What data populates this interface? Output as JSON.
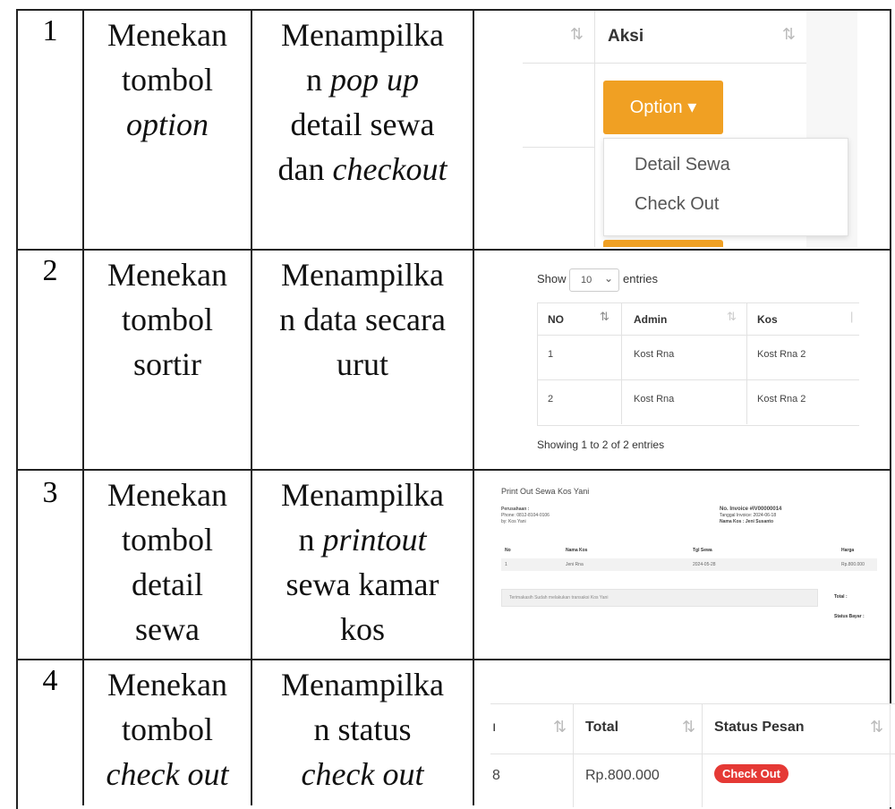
{
  "rows": [
    {
      "no": "1",
      "action_lines": [
        "Menekan",
        "tombol",
        "option"
      ],
      "result_lines": [
        "Menampilka",
        "n pop up",
        "detail sewa",
        "dan checkout"
      ]
    },
    {
      "no": "2",
      "action_lines": [
        "Menekan",
        "tombol",
        "sortir"
      ],
      "result_lines": [
        "Menampilka",
        "n data secara",
        "urut"
      ]
    },
    {
      "no": "3",
      "action_lines": [
        "Menekan",
        "tombol",
        "detail",
        "sewa"
      ],
      "result_lines": [
        "Menampilka",
        "n printout",
        "sewa kamar",
        "kos"
      ]
    },
    {
      "no": "4",
      "action_lines": [
        "Menekan",
        "tombol",
        "check out"
      ],
      "result_lines": [
        "Menampilka",
        "n status",
        "check out"
      ]
    }
  ],
  "shot1": {
    "header_aksi": "Aksi",
    "option_button": "Option ▾",
    "menu_items": [
      "Detail Sewa",
      "Check Out"
    ]
  },
  "shot2": {
    "show_label": "Show",
    "select_value": "10",
    "entries_label": "entries",
    "headers": [
      "NO",
      "Admin",
      "Kos"
    ],
    "rows": [
      [
        "1",
        "Kost Rna",
        "Kost Rna 2"
      ],
      [
        "2",
        "Kost Rna",
        "Kost Rna 2"
      ]
    ],
    "footer": "Showing 1 to 2 of 2 entries"
  },
  "shot3": {
    "title": "Print Out Sewa Kos Yani",
    "left_lines": [
      "Perusahaan :",
      "Phone: 0812-8104-0106",
      "by: Kos Yani"
    ],
    "right_lines": [
      "No. Invoice #IV00000014",
      "Tanggal Invoice: 2024-06-18",
      "Nama Kos : Jeni Susanto"
    ],
    "headers": [
      "No",
      "Nama Kos",
      "Tgl Sewa",
      "Harga"
    ],
    "row": [
      "1",
      "Jeni Rna",
      "2024-05-28",
      "Rp.800.000"
    ],
    "note": "Terimakasih Sudah melakukan transaksi Kos Yani",
    "total_label": "Total :",
    "status_label": "Status Bayar :"
  },
  "shot4": {
    "headers": [
      "Total",
      "Status Pesan"
    ],
    "left_fragment": "8",
    "total_value": "Rp.800.000",
    "badge": "Check Out",
    "badge_color": "#e53935"
  }
}
